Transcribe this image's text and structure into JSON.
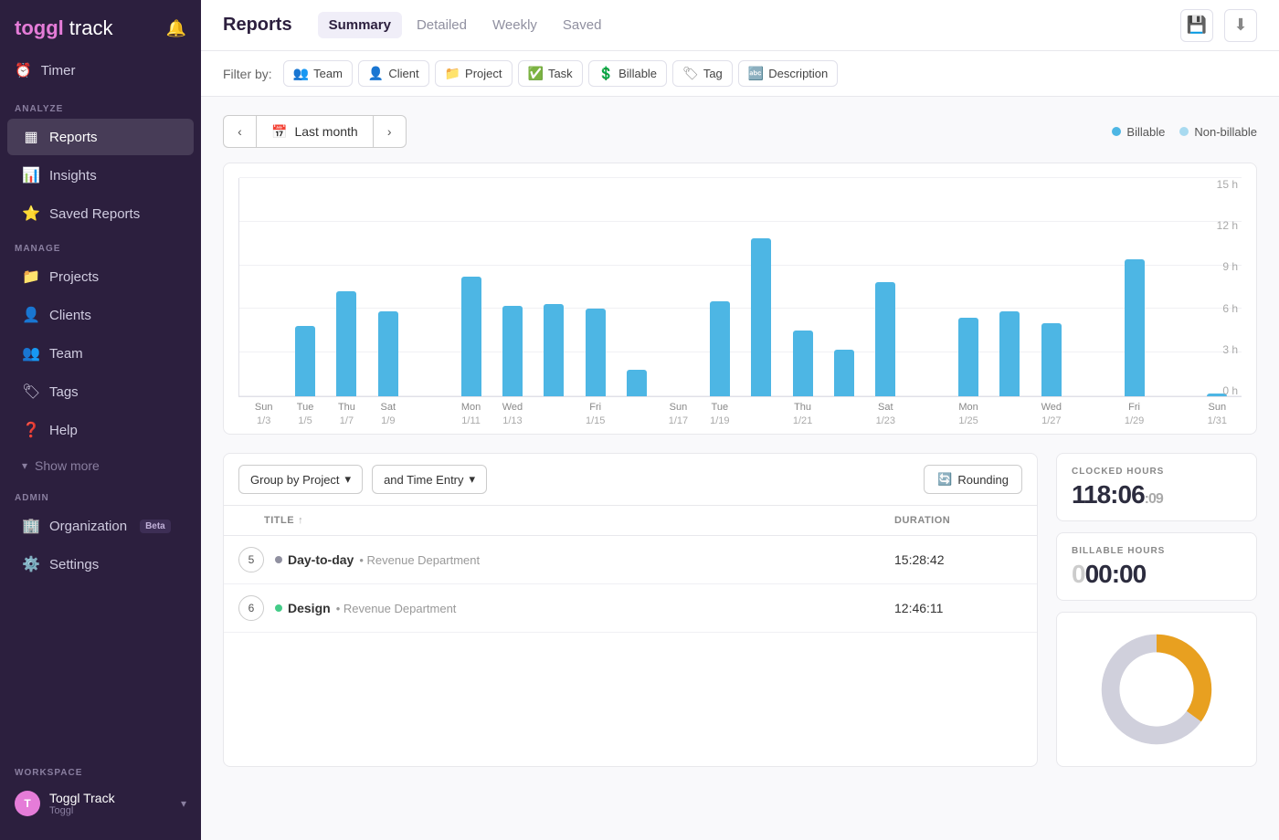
{
  "sidebar": {
    "logo": "toggl",
    "logo_track": "track",
    "bell_icon": "🔔",
    "timer_label": "Timer",
    "analyze_label": "ANALYZE",
    "nav_reports": "Reports",
    "nav_insights": "Insights",
    "nav_saved_reports": "Saved Reports",
    "manage_label": "MANAGE",
    "nav_projects": "Projects",
    "nav_clients": "Clients",
    "nav_team": "Team",
    "nav_tags": "Tags",
    "nav_help": "Help",
    "show_more": "Show more",
    "admin_label": "ADMIN",
    "nav_organization": "Organization",
    "org_badge": "Beta",
    "nav_settings": "Settings",
    "workspace_label": "WORKSPACE",
    "workspace_name": "Toggl Track",
    "workspace_sub": "Toggl"
  },
  "topnav": {
    "title": "Reports",
    "tabs": [
      "Summary",
      "Detailed",
      "Weekly",
      "Saved"
    ],
    "active_tab": "Summary",
    "save_icon": "💾",
    "download_icon": "⬇"
  },
  "filters": {
    "label": "Filter by:",
    "items": [
      "Team",
      "Client",
      "Project",
      "Task",
      "Billable",
      "Tag",
      "Description"
    ]
  },
  "daterange": {
    "prev_icon": "‹",
    "next_icon": "›",
    "label": "Last month",
    "cal_icon": "📅",
    "legend_billable": "Billable",
    "legend_nonbillable": "Non-billable",
    "billable_color": "#4db6e4",
    "nonbillable_color": "#a8daf0"
  },
  "chart": {
    "y_labels": [
      "0 h",
      "3 h",
      "6 h",
      "9 h",
      "12 h",
      "15 h"
    ],
    "max_hours": 15,
    "bars": [
      {
        "day": "Sun",
        "date": "1/3",
        "hours": 0
      },
      {
        "day": "Tue",
        "date": "1/5",
        "hours": 4.8
      },
      {
        "day": "Thu",
        "date": "1/7",
        "hours": 7.2
      },
      {
        "day": "Sat",
        "date": "1/9",
        "hours": 5.8
      },
      {
        "day": "",
        "date": "",
        "hours": 0
      },
      {
        "day": "Mon",
        "date": "1/11",
        "hours": 8.2
      },
      {
        "day": "Wed",
        "date": "1/13",
        "hours": 6.2
      },
      {
        "day": "",
        "date": "",
        "hours": 6.3
      },
      {
        "day": "Fri",
        "date": "1/15",
        "hours": 6.0
      },
      {
        "day": "",
        "date": "",
        "hours": 1.8
      },
      {
        "day": "Sun",
        "date": "1/17",
        "hours": 0
      },
      {
        "day": "Tue",
        "date": "1/19",
        "hours": 6.5
      },
      {
        "day": "",
        "date": "",
        "hours": 10.8
      },
      {
        "day": "Thu",
        "date": "1/21",
        "hours": 4.5
      },
      {
        "day": "",
        "date": "",
        "hours": 3.2
      },
      {
        "day": "Sat",
        "date": "1/23",
        "hours": 7.8
      },
      {
        "day": "",
        "date": "",
        "hours": 0
      },
      {
        "day": "Mon",
        "date": "1/25",
        "hours": 5.4
      },
      {
        "day": "",
        "date": "",
        "hours": 5.8
      },
      {
        "day": "Wed",
        "date": "1/27",
        "hours": 5.0
      },
      {
        "day": "",
        "date": "",
        "hours": 0
      },
      {
        "day": "Fri",
        "date": "1/29",
        "hours": 9.4
      },
      {
        "day": "",
        "date": "",
        "hours": 0
      },
      {
        "day": "Sun",
        "date": "1/31",
        "hours": 0.2
      }
    ]
  },
  "table": {
    "group_by_label": "Group by Project",
    "and_label": "and Time Entry",
    "rounding_label": "Rounding",
    "col_title": "TITLE",
    "col_duration": "DURATION",
    "rows": [
      {
        "badge": "5",
        "project": "Day-to-day",
        "client": "Revenue Department",
        "duration": "15:28:42",
        "dot_color": "#9090a0"
      },
      {
        "badge": "6",
        "project": "Design",
        "client": "Revenue Department",
        "duration": "12:46:11",
        "dot_color": "#44cc88"
      }
    ]
  },
  "stats": {
    "clocked_label": "CLOCKED HOURS",
    "clocked_value": "118:06",
    "clocked_small": ":09",
    "billable_label": "BILLABLE HOURS",
    "billable_value": "0",
    "billable_main": "00:00",
    "billable_small": ""
  }
}
